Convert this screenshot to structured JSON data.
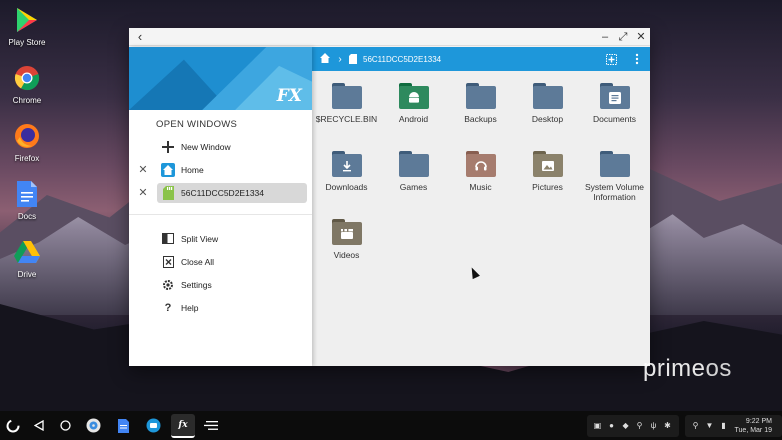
{
  "desktop": {
    "icons": [
      {
        "label": "Play Store"
      },
      {
        "label": "Chrome"
      },
      {
        "label": "Firefox"
      },
      {
        "label": "Docs"
      },
      {
        "label": "Drive"
      }
    ],
    "watermark": {
      "prime": "prime",
      "os": "os"
    }
  },
  "window": {
    "title_back": "‹",
    "controls": {
      "minimize": "–",
      "maximize": "⤢",
      "close": "✕"
    }
  },
  "sidebar": {
    "logo": "FX",
    "section_title": "OPEN WINDOWS",
    "new_window": "New Window",
    "open_windows": [
      {
        "label": "Home"
      },
      {
        "label": "56C11DCC5D2E1334"
      }
    ],
    "menu": [
      {
        "label": "Split View"
      },
      {
        "label": "Close All"
      },
      {
        "label": "Settings"
      },
      {
        "label": "Help"
      }
    ]
  },
  "toolbar": {
    "path": "56C11DCC5D2E1334"
  },
  "items": [
    {
      "name": "$RECYCLE.BIN",
      "color": "#5d7a98",
      "glyph": ""
    },
    {
      "name": "Android",
      "color": "#2e8a5e",
      "glyph": "android"
    },
    {
      "name": "Backups",
      "color": "#5d7a98",
      "glyph": ""
    },
    {
      "name": "Desktop",
      "color": "#5d7a98",
      "glyph": ""
    },
    {
      "name": "Documents",
      "color": "#5d7a98",
      "glyph": "doc"
    },
    {
      "name": "Downloads",
      "color": "#5d7a98",
      "glyph": "download"
    },
    {
      "name": "Games",
      "color": "#5d7a98",
      "glyph": ""
    },
    {
      "name": "Music",
      "color": "#a67c6e",
      "glyph": "music"
    },
    {
      "name": "Pictures",
      "color": "#8b826b",
      "glyph": "picture"
    },
    {
      "name": "System Volume Information",
      "color": "#5d7a98",
      "glyph": ""
    },
    {
      "name": "Videos",
      "color": "#7f7765",
      "glyph": "video"
    }
  ],
  "taskbar": {
    "clock_time": "9:22 PM",
    "clock_date": "Tue, Mar 19"
  },
  "colors": {
    "accent": "#1e97da",
    "sidebar_header": "#1e8ed0",
    "active_row": "#d8d8d8"
  }
}
